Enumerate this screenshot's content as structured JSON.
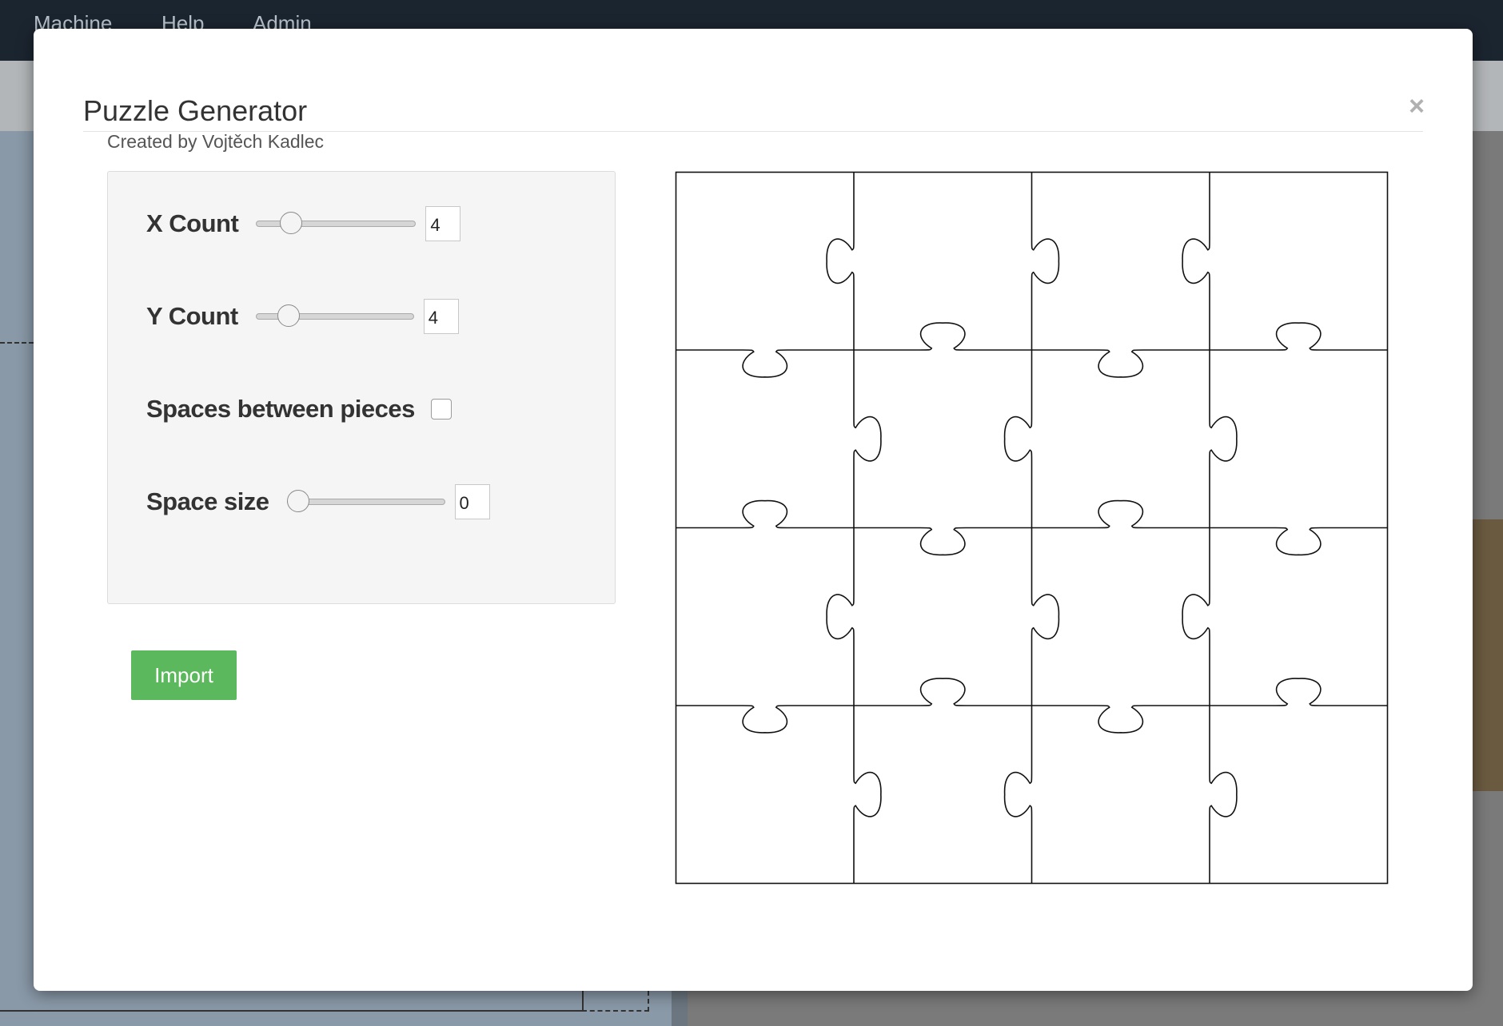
{
  "background": {
    "menu": [
      "Machine",
      "Help",
      "Admin"
    ]
  },
  "modal": {
    "title": "Puzzle Generator",
    "close_symbol": "×",
    "credit": "Created by Vojtěch Kadlec"
  },
  "controls": {
    "x_count": {
      "label": "X Count",
      "value": "4",
      "slider_fraction": 0.17
    },
    "y_count": {
      "label": "Y Count",
      "value": "4",
      "slider_fraction": 0.16
    },
    "spaces_between_pieces": {
      "label": "Spaces between pieces",
      "checked": false
    },
    "space_size": {
      "label": "Space size",
      "value": "0",
      "slider_fraction": 0.0
    }
  },
  "import_button": {
    "label": "Import",
    "color": "#5cb85c"
  },
  "preview": {
    "columns": 4,
    "rows": 4
  }
}
